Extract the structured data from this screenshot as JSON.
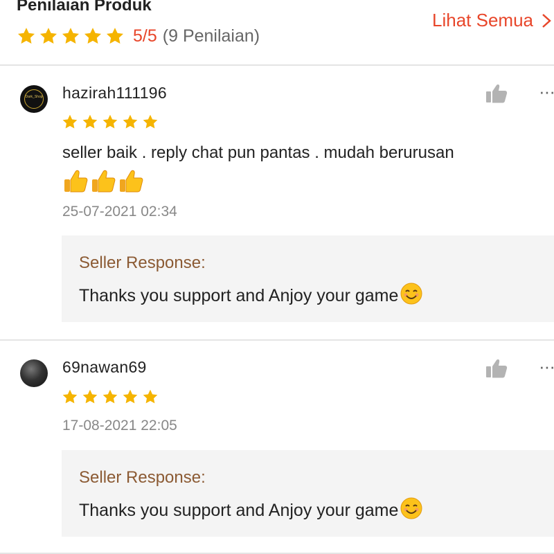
{
  "header": {
    "title": "Penilaian Produk",
    "score": "5/5",
    "count": "(9 Penilaian)",
    "see_all": "Lihat Semua",
    "stars": 5
  },
  "colors": {
    "accent": "#e8462a",
    "star": "#f5b400",
    "response_label": "#8b5a33",
    "response_bg": "#f4f4f4"
  },
  "reviews": [
    {
      "username": "hazirah111196",
      "avatar_text": "Dark_Shop",
      "stars": 5,
      "comment": "seller baik . reply chat pun pantas . mudah berurusan",
      "emojis": [
        "thumbs-up-emoji",
        "thumbs-up-emoji",
        "thumbs-up-emoji"
      ],
      "date": "25-07-2021 02:34",
      "response_label": "Seller Response:",
      "response_text": "Thanks you support and Anjoy your game"
    },
    {
      "username": "69nawan69",
      "stars": 5,
      "date": "17-08-2021 22:05",
      "response_label": "Seller Response:",
      "response_text": "Thanks you support and Anjoy your game"
    }
  ],
  "icons": {
    "like": "thumbs-up-icon",
    "more": "more-options-icon",
    "chevron": "chevron-right-icon",
    "smile": "smiling-face-emoji"
  }
}
